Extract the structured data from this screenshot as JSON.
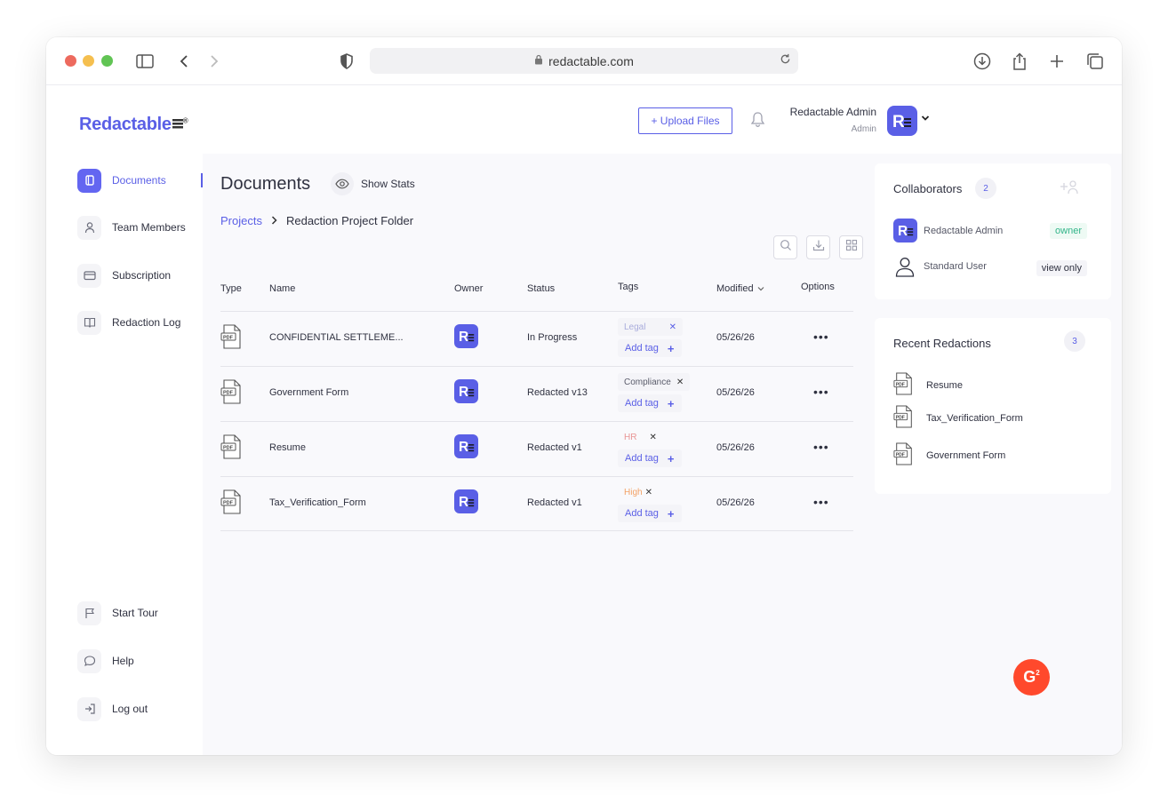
{
  "browser": {
    "url": "redactable.com"
  },
  "brand": {
    "name": "Redactable",
    "accent": "#5a5fe6"
  },
  "sidebar": {
    "items": [
      {
        "label": "Documents",
        "icon": "documents-icon",
        "active": true
      },
      {
        "label": "Team Members",
        "icon": "user-icon"
      },
      {
        "label": "Subscription",
        "icon": "card-icon"
      },
      {
        "label": "Redaction Log",
        "icon": "book-icon"
      }
    ],
    "bottom": [
      {
        "label": "Start Tour",
        "icon": "flag-icon"
      },
      {
        "label": "Help",
        "icon": "chat-icon"
      },
      {
        "label": "Log out",
        "icon": "logout-icon"
      }
    ]
  },
  "header": {
    "upload_label": "+ Upload Files",
    "user_name": "Redactable Admin",
    "user_role": "Admin"
  },
  "page": {
    "title": "Documents",
    "show_stats": "Show Stats",
    "breadcrumb": {
      "root": "Projects",
      "current": "Redaction Project Folder"
    }
  },
  "table": {
    "columns": {
      "type": "Type",
      "name": "Name",
      "owner": "Owner",
      "status": "Status",
      "tags": "Tags",
      "modified": "Modified",
      "options": "Options"
    },
    "add_tag": "Add tag",
    "rows": [
      {
        "name": "CONFIDENTIAL SETTLEME...",
        "status": "In Progress",
        "tag": "Legal",
        "tag_color": "#a9acdc",
        "modified": "05/26/26"
      },
      {
        "name": "Government Form",
        "status": "Redacted v13",
        "tag": "Compliance",
        "tag_color": "#5a5c6b",
        "modified": "05/26/26"
      },
      {
        "name": "Resume",
        "status": "Redacted v1",
        "tag": "HR",
        "tag_color": "#e89595",
        "modified": "05/26/26"
      },
      {
        "name": "Tax_Verification_Form",
        "status": "Redacted v1",
        "tag": "High",
        "tag_color": "#f3a266",
        "modified": "05/26/26"
      }
    ]
  },
  "collaborators": {
    "title": "Collaborators",
    "count": "2",
    "items": [
      {
        "name": "Redactable Admin",
        "role": "owner",
        "role_color": "#33b58a"
      },
      {
        "name": "Standard User",
        "role": "view only",
        "role_color": "#2f3140"
      }
    ]
  },
  "recent": {
    "title": "Recent Redactions",
    "count": "3",
    "items": [
      {
        "name": "Resume"
      },
      {
        "name": "Tax_Verification_Form"
      },
      {
        "name": "Government Form"
      }
    ]
  },
  "g2_badge": "G"
}
